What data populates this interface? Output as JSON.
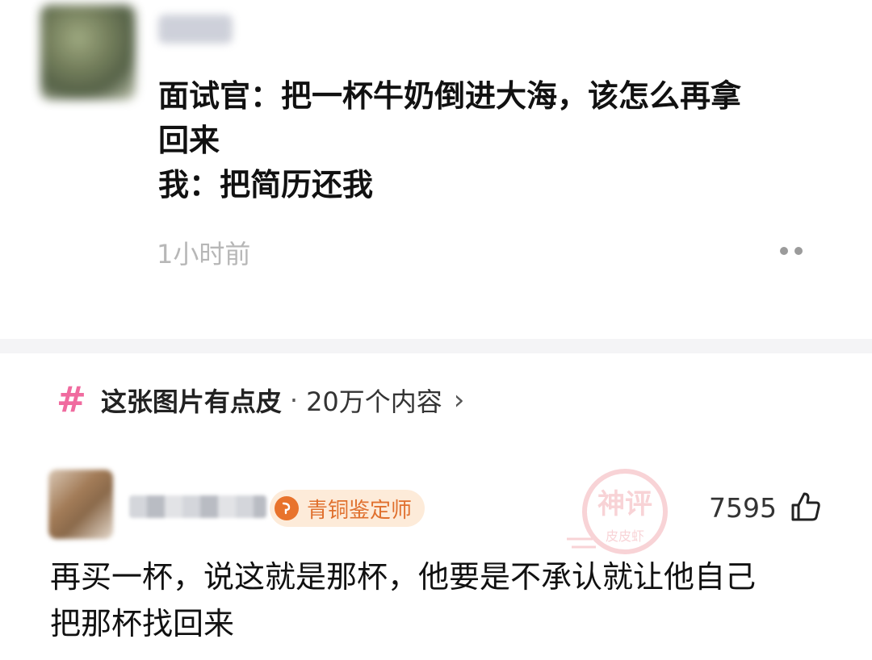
{
  "post": {
    "lines": [
      "面试官：把一杯牛奶倒进大海，该怎么再拿",
      "回来",
      "我：把简历还我"
    ],
    "timestamp": "1小时前"
  },
  "topic": {
    "hash": "#",
    "name": "这张图片有点皮",
    "separator": "·",
    "count": "20万个内容",
    "arrow": "›"
  },
  "comment": {
    "badge_label": "青铜鉴定师",
    "like_count": "7595",
    "lines": [
      "再买一杯，说这就是那杯，他要是不承认就让他自己",
      "把那杯找回来"
    ]
  },
  "stamp": {
    "text_top": "神评",
    "text_bottom": "皮皮虾"
  },
  "colors": {
    "accent_pink": "#f06b9f",
    "badge_orange": "#e0702e",
    "badge_bg": "#fdebd9",
    "stamp_red": "#e23a4a"
  },
  "icons": {
    "more": "more-dots-icon",
    "topic": "hash-icon",
    "like": "thumbs-up-icon",
    "arrow": "chevron-right-icon"
  }
}
